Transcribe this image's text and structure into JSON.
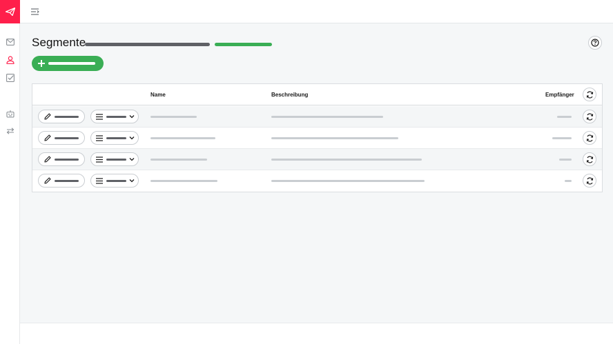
{
  "app": {
    "brand_color": "#ff1f4b",
    "accent_green": "#3aae55"
  },
  "sidebar": {
    "logo_icon": "paper-plane-icon",
    "items": [
      {
        "icon": "mail-icon",
        "active": false
      },
      {
        "icon": "user-icon",
        "active": true
      },
      {
        "icon": "checkbox-icon",
        "active": false
      },
      {
        "icon": "robot-icon",
        "active": false
      },
      {
        "icon": "transfer-arrows-icon",
        "active": false
      }
    ]
  },
  "topbar": {
    "toggle_icon": "menu-collapse-icon"
  },
  "page": {
    "title": "Segmente",
    "help_icon": "help-circle-icon"
  },
  "actions": {
    "add_icon": "plus-icon"
  },
  "table": {
    "columns": {
      "name": "Name",
      "description": "Beschreibung",
      "recipients": "Empfänger"
    },
    "rows": [
      {
        "edit_icon": "pencil-icon",
        "menu_icon": "list-icon"
      },
      {
        "edit_icon": "pencil-icon",
        "menu_icon": "list-icon"
      },
      {
        "edit_icon": "pencil-icon",
        "menu_icon": "list-icon"
      },
      {
        "edit_icon": "pencil-icon",
        "menu_icon": "list-icon"
      }
    ]
  }
}
